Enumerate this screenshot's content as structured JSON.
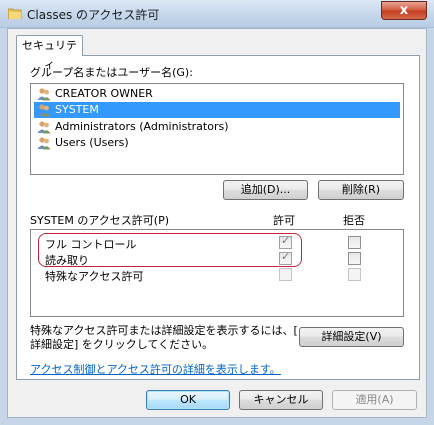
{
  "window": {
    "title": "Classes のアクセス許可",
    "close_glyph": "x"
  },
  "tabs": [
    {
      "label": "セキュリティ",
      "selected": true
    }
  ],
  "security": {
    "group_label": "グループ名またはユーザー名(G):",
    "users": [
      {
        "name": "CREATOR OWNER",
        "selected": false
      },
      {
        "name": "SYSTEM",
        "selected": true
      },
      {
        "name": "Administrators (Administrators)",
        "selected": false
      },
      {
        "name": "Users (Users)",
        "selected": false
      }
    ],
    "add_label": "追加(D)...",
    "remove_label": "削除(R)",
    "perm_header": "SYSTEM のアクセス許可(P)",
    "allow_header": "許可",
    "deny_header": "拒否",
    "permissions": [
      {
        "name": "フル コントロール",
        "allow": true,
        "deny": false,
        "enabled": true
      },
      {
        "name": "読み取り",
        "allow": true,
        "deny": false,
        "enabled": true
      },
      {
        "name": "特殊なアクセス許可",
        "allow": false,
        "deny": false,
        "enabled": false
      }
    ],
    "special_text_line1": "特殊なアクセス許可または詳細設定を表示するには、[",
    "special_text_line2": "詳細設定] をクリックしてください。",
    "advanced_label": "詳細設定(V)",
    "help_link": "アクセス制御とアクセス許可の詳細を表示します。"
  },
  "footer": {
    "ok_label": "OK",
    "cancel_label": "キャンセル",
    "apply_label": "適用(A)"
  },
  "colors": {
    "selection": "#3399ff",
    "highlight_annotation": "#c4263b",
    "link": "#0066cc"
  }
}
